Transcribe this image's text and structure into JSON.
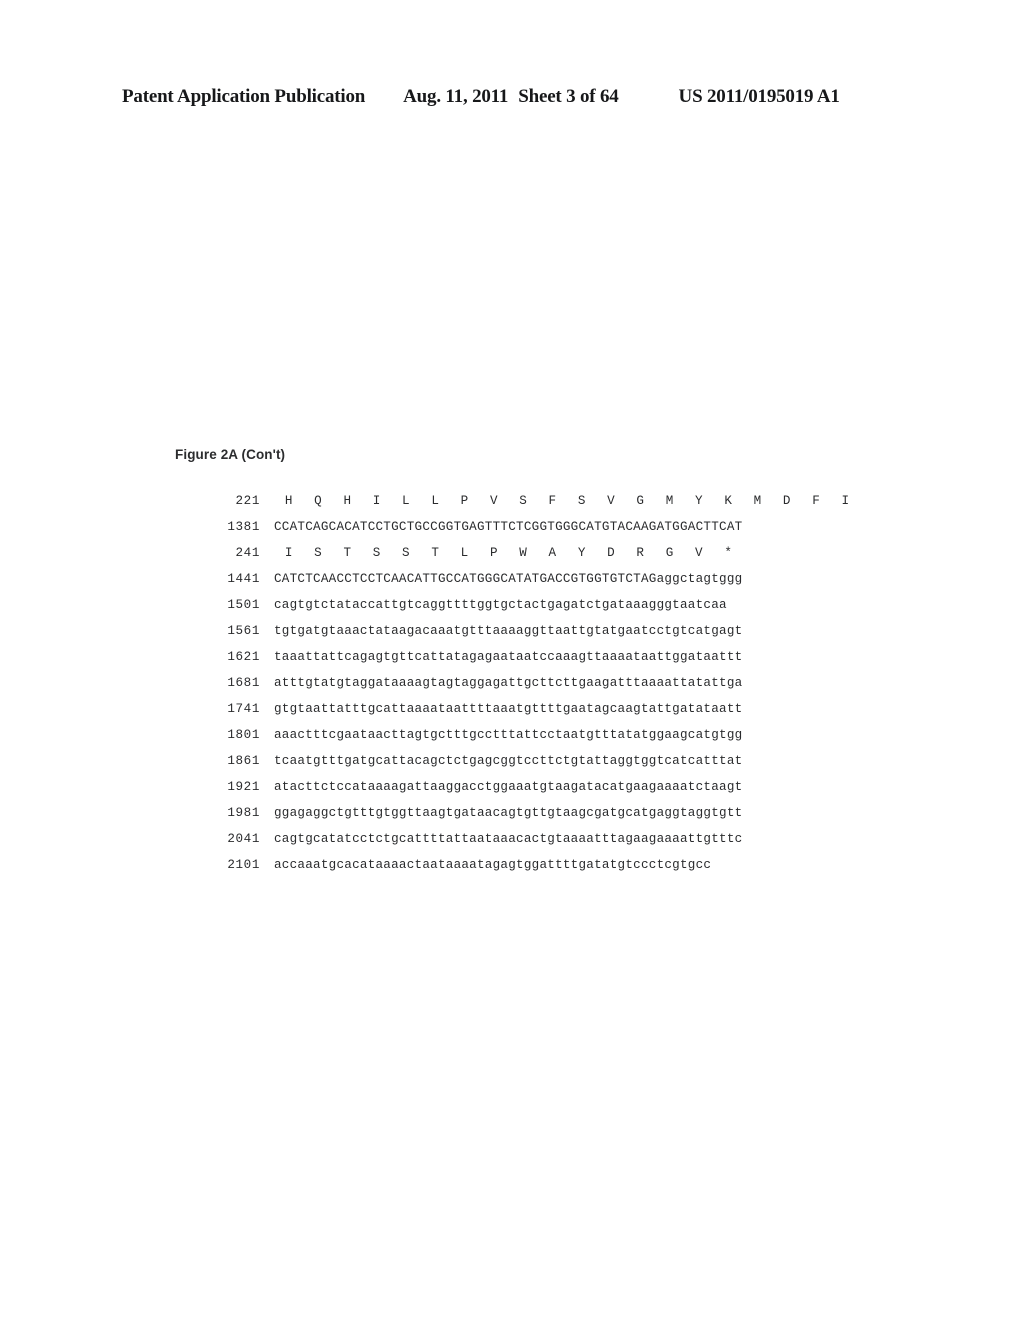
{
  "header": {
    "publication": "Patent Application Publication",
    "date": "Aug. 11, 2011",
    "sheet": "Sheet 3 of 64",
    "patent_number": "US 2011/0195019 A1"
  },
  "figure": {
    "caption": "Figure 2A (Con't)"
  },
  "sequence": {
    "rows": [
      {
        "index": "221",
        "type": "protein",
        "residues": "H Q H I L L P V S F S V G M Y K M D F I"
      },
      {
        "index": "1381",
        "type": "nucleotide",
        "residues": "CCATCAGCACATCCTGCTGCCGGTGAGTTTCTCGGTGGGCATGTACAAGATGGACTTCAT"
      },
      {
        "index": "241",
        "type": "protein",
        "residues": "I S T S S T L P W A Y D R G V *"
      },
      {
        "index": "1441",
        "type": "nucleotide",
        "residues": "CATCTCAACCTCCTCAACATTGCCATGGGCATATGACCGTGGTGTCTAGaggctagtggg"
      },
      {
        "index": "1501",
        "type": "nucleotide",
        "residues": "cagtgtctataccattgtcaggttttggtgctactgagatctgataaagggtaatcaa"
      },
      {
        "index": "1561",
        "type": "nucleotide",
        "residues": "tgtgatgtaaactataagacaaatgtttaaaaggttaattgtatgaatcctgtcatgagt"
      },
      {
        "index": "1621",
        "type": "nucleotide",
        "residues": "taaattattcagagtgttcattatagagaataatccaaagttaaaataattggataattt"
      },
      {
        "index": "1681",
        "type": "nucleotide",
        "residues": "atttgtatgtaggataaaagtagtaggagattgcttcttgaagatttaaaattatattga"
      },
      {
        "index": "1741",
        "type": "nucleotide",
        "residues": "gtgtaattatttgcattaaaataattttaaatgttttgaatagcaagtattgatataatt"
      },
      {
        "index": "1801",
        "type": "nucleotide",
        "residues": "aaactttcgaataacttagtgctttgcctttattcctaatgtttatatggaagcatgtgg"
      },
      {
        "index": "1861",
        "type": "nucleotide",
        "residues": "tcaatgtttgatgcattacagctctgagcggtccttctgtattaggtggtcatcatttat"
      },
      {
        "index": "1921",
        "type": "nucleotide",
        "residues": "atacttctccataaaagattaaggacctggaaatgtaagatacatgaagaaaatctaagt"
      },
      {
        "index": "1981",
        "type": "nucleotide",
        "residues": "ggagaggctgtttgtggttaagtgataacagtgttgtaagcgatgcatgaggtaggtgtt"
      },
      {
        "index": "2041",
        "type": "nucleotide",
        "residues": "cagtgcatatcctctgcattttattaataaacactgtaaaatttagaagaaaattgtttc"
      },
      {
        "index": "2101",
        "type": "nucleotide",
        "residues": "accaaatgcacataaaactaataaaatagagtggattttgatatgtccctcgtgcc"
      }
    ]
  }
}
